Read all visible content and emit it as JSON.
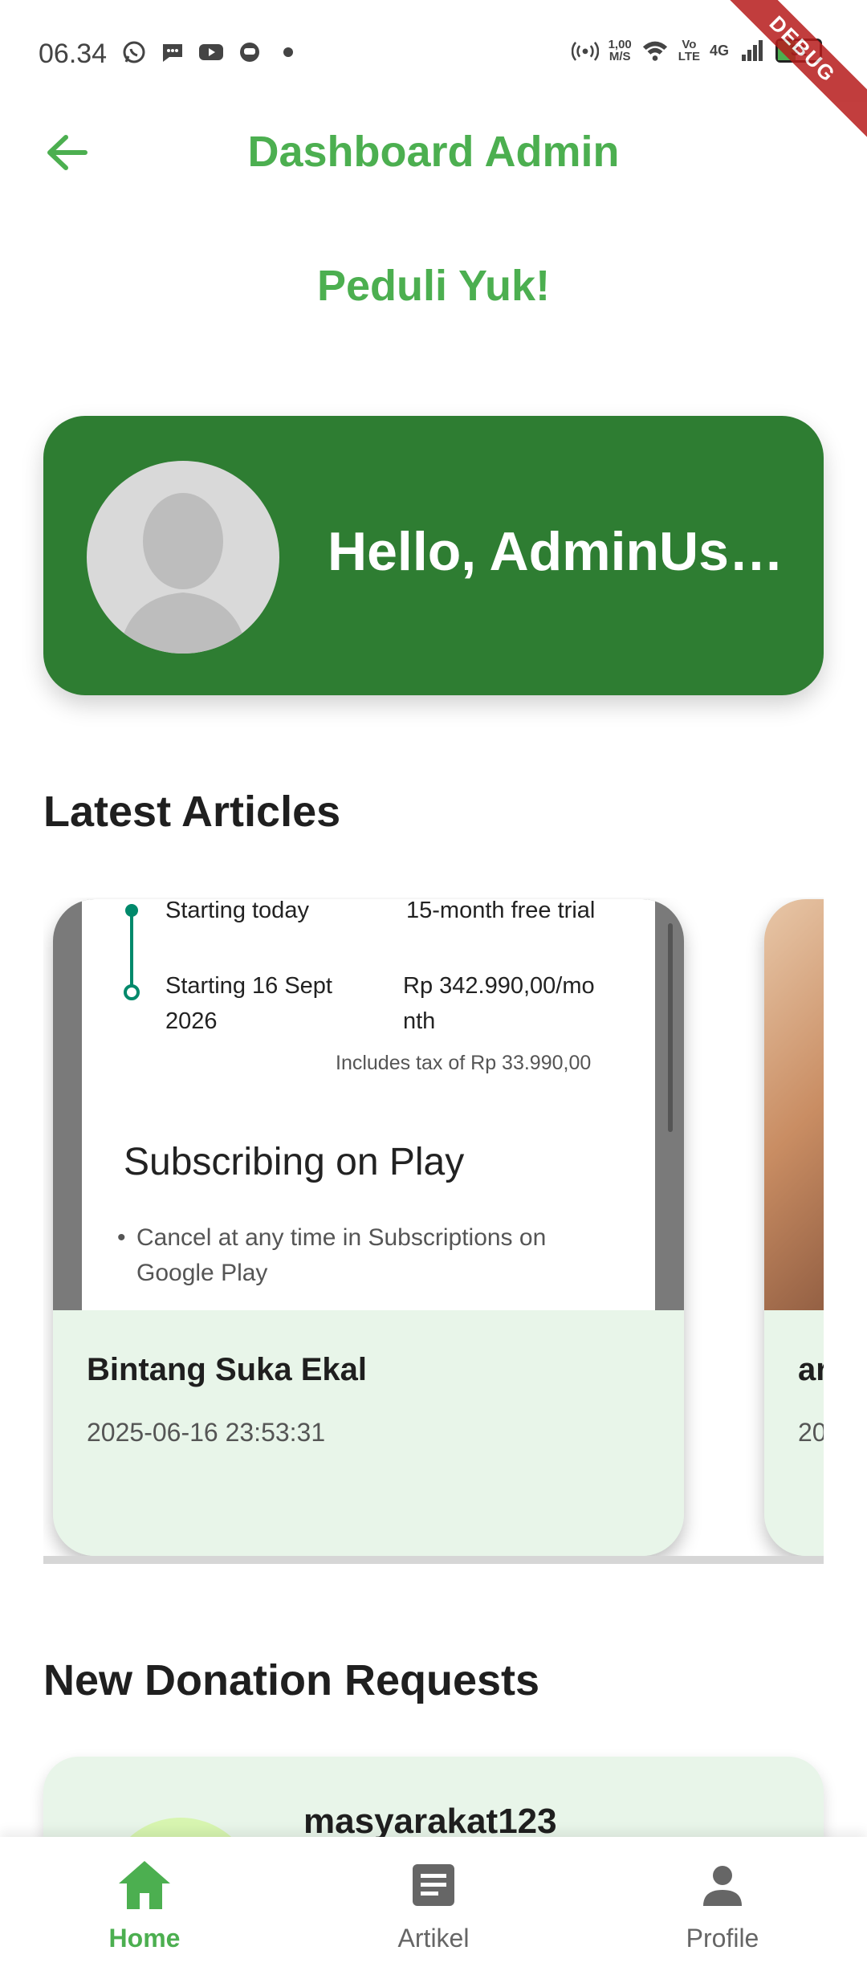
{
  "status_bar": {
    "time": "06.34",
    "left_icons": [
      "whatsapp-icon",
      "messages-icon",
      "youtube-icon",
      "app-icon",
      "dot-icon"
    ],
    "network_speed_value": "1,00",
    "network_speed_unit": "M/S",
    "volte_top": "Vo",
    "volte_bottom": "LTE",
    "signal_label": "4G",
    "battery_level": "31",
    "debug_label": "DEBUG"
  },
  "app_bar": {
    "title": "Dashboard Admin"
  },
  "brand": "Peduli Yuk!",
  "greeting": "Hello, AdminUs…",
  "latest_articles": {
    "heading": "Latest Articles",
    "items": [
      {
        "title": "Bintang Suka Ekal",
        "date": "2025-06-16 23:53:31",
        "image": {
          "row1_left": "Starting today",
          "row1_right": "15-month free trial",
          "row2_left_line1": "Starting 16 Sept",
          "row2_left_line2": "2026",
          "row2_right_line1": "Rp 342.990,00/mo",
          "row2_right_line2": "nth",
          "tax_note": "Includes tax of Rp 33.990,00",
          "heading": "Subscribing on Play",
          "bullet": "Cancel at any time in Subscriptions on Google Play"
        }
      },
      {
        "title": "ar",
        "date": "20"
      }
    ]
  },
  "donations": {
    "heading": "New Donation Requests",
    "items": [
      {
        "username": "masyarakat123"
      }
    ]
  },
  "bottom_nav": {
    "items": [
      {
        "label": "Home",
        "icon": "home-icon",
        "active": true
      },
      {
        "label": "Artikel",
        "icon": "article-icon",
        "active": false
      },
      {
        "label": "Profile",
        "icon": "person-icon",
        "active": false
      }
    ]
  },
  "colors": {
    "primary": "#4caf50",
    "card_green": "#2e7d32",
    "light_green": "#e8f5e9"
  }
}
